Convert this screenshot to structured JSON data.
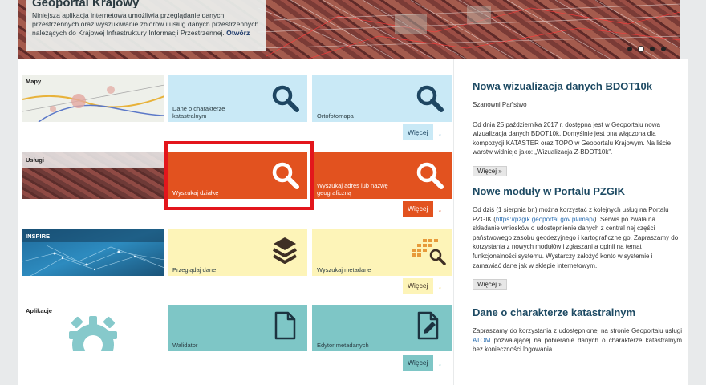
{
  "banner": {
    "title": "Geoportal Krajowy",
    "text": "Niniejsza aplikacja internetowa umożliwia przeglądanie danych przestrzennych oraz wyszukiwanie zbiorów i usług danych przestrzennych należących do Krajowej Infrastruktury Informacji Przestrzennej.",
    "link": "Otwórz"
  },
  "categories": {
    "mapy": {
      "label": "Mapy",
      "tile1": "Dane o charakterze katastralnym",
      "tile2": "Ortofotomapa",
      "more": "Więcej"
    },
    "uslugi": {
      "label": "Usługi",
      "tile1": "Wyszukaj działkę",
      "tile2": "Wyszukaj adres lub nazwę geograficzną",
      "more": "Więcej"
    },
    "inspire": {
      "label": "INSPIRE",
      "tile1": "Przeglądaj dane",
      "tile2": "Wyszukaj metadane",
      "more": "Więcej"
    },
    "aplikacje": {
      "label": "Aplikacje",
      "tile1": "Walidator",
      "tile2": "Edytor metadanych",
      "more": "Więcej"
    }
  },
  "news": [
    {
      "title": "Nowa wizualizacja danych BDOT10k",
      "greeting": "Szanowni Państwo",
      "body": "Od dnia 25 października 2017 r. dostępna jest w Geoportalu nowa wizualizacja danych BDOT10k. Domyślnie jest ona włączona dla kompozycji KATASTER oraz TOPO w Geoportalu Krajowym. Na liście warstw widnieje jako: „Wizualizacja Z-BDOT10k”.",
      "more": "Więcej »"
    },
    {
      "title": "Nowe moduły w Portalu PZGIK",
      "body_before": "Od dziś (1 sierpnia br.) można korzystać z kolejnych usług na Portalu PZGIK (",
      "link": "https://pzgik.geoportal.gov.pl/imap/",
      "body_after": "). Serwis po zwala na składanie wniosków o udostępnienie danych z central nej części państwowego zasobu geodezyjnego i kartograficzne go. Zapraszamy do korzystania z nowych modułów i zgłaszani a opinii na temat funkcjonalności systemu. Wystarczy założyć konto w systemie i zamawiać dane jak w sklepie internetowym.",
      "more": "Więcej »"
    },
    {
      "title": "Dane o charakterze katastralnym",
      "body_before": "Zapraszamy do korzystania z udostępnionej na stronie Geoportalu usługi ",
      "link": "ATOM",
      "body_after": " pozwalającej na pobieranie danych o charakterze katastralnym bez konieczności logowania."
    }
  ],
  "colors": {
    "blue_tile": "#c9e9f6",
    "orange_tile": "#e2521f",
    "yellow_tile": "#fdf4b8",
    "teal_tile": "#7ec6c6",
    "highlight": "#e3161c"
  }
}
